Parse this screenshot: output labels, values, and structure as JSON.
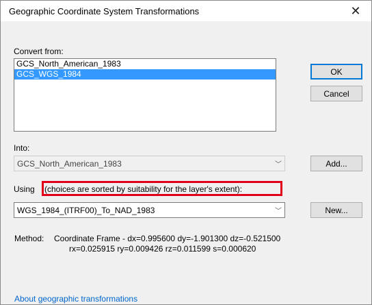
{
  "window": {
    "title": "Geographic Coordinate System Transformations",
    "close_glyph": "✕"
  },
  "convert_from": {
    "label": "Convert from:",
    "items": [
      {
        "label": "GCS_North_American_1983",
        "selected": false
      },
      {
        "label": "GCS_WGS_1984",
        "selected": true
      }
    ]
  },
  "buttons": {
    "ok": "OK",
    "cancel": "Cancel",
    "add": "Add...",
    "new": "New..."
  },
  "into": {
    "label": "Into:",
    "value": "GCS_North_American_1983",
    "chevron": "﹀"
  },
  "using": {
    "label_prefix": "Using",
    "label_highlight": "(choices are sorted by suitability for the layer's extent):",
    "value": "WGS_1984_(ITRF00)_To_NAD_1983",
    "chevron": "﹀"
  },
  "method": {
    "label": "Method:",
    "line1": "Coordinate Frame - dx=0.995600 dy=-1.901300 dz=-0.521500",
    "line2": "rx=0.025915 ry=0.009426 rz=0.011599 s=0.000620"
  },
  "footer": {
    "link": "About geographic transformations"
  },
  "colors": {
    "selection": "#3399ff",
    "highlight_box": "#e0001a",
    "link": "#0066cc",
    "default_button_border": "#0078d7"
  }
}
